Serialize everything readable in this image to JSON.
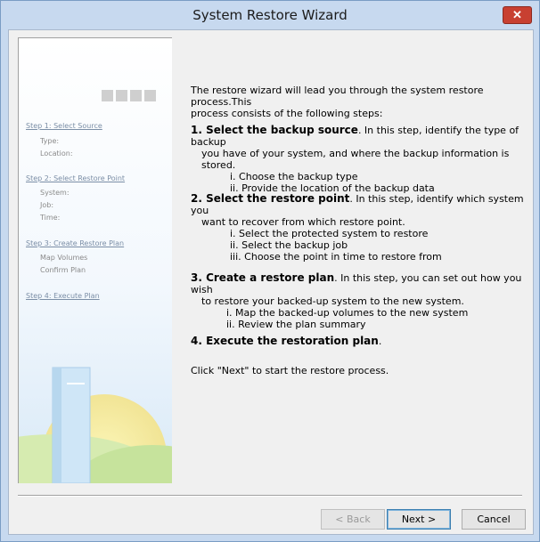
{
  "window": {
    "title": "System Restore Wizard",
    "close_label": "✕"
  },
  "sidebar": {
    "steps": [
      {
        "label": "Step 1: Select Source",
        "sub": [
          "Type:",
          "Location:"
        ]
      },
      {
        "label": "Step 2: Select Restore Point",
        "sub": [
          "System:",
          "Job:",
          "Time:"
        ]
      },
      {
        "label": "Step 3: Create Restore Plan",
        "sub": [
          "Map Volumes",
          "Confirm Plan"
        ]
      },
      {
        "label": "Step 4: Execute Plan",
        "sub": []
      }
    ]
  },
  "main": {
    "intro_1": "The restore wizard will lead you through the system restore process.This",
    "intro_2": "process consists of the following steps:",
    "s1": {
      "title": "1.  Select the backup source",
      "text1": ".   In this step, identify the type of backup",
      "text2": "you have of your system, and where the backup information is stored.",
      "items": [
        "i.   Choose the  backup type",
        "ii.  Provide the location of the backup data"
      ]
    },
    "s2": {
      "title": "2.  Select the restore point",
      "text1": ".  In this step, identify which system you",
      "text2": "want  to recover from  which restore point.",
      "items": [
        "i.  Select the protected system to restore",
        "ii. Select the backup job",
        "iii. Choose the point in time to restore from"
      ]
    },
    "s3": {
      "title": "3.  Create a restore plan",
      "text1": ".  In this step, you can set out how you wish",
      "text2": "to restore your backed-up system to the new system.",
      "items": [
        "i.   Map the backed-up volumes to the new system",
        "ii. Review the plan summary"
      ]
    },
    "s4": {
      "title": "4.  Execute the restoration plan",
      "text1": "."
    },
    "footer": "Click \"Next\" to start the restore process."
  },
  "buttons": {
    "back": "< Back",
    "next": "Next >",
    "cancel": "Cancel"
  },
  "colors": {
    "title_bar": "#c7d9ef",
    "close": "#c84031",
    "step_link": "#7b8ea6"
  }
}
